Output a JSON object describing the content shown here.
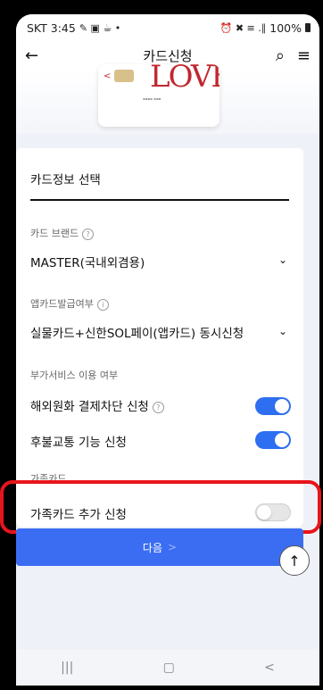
{
  "status": {
    "time": "SKT 3:45",
    "left_icons": "✎ ▣ ☕ •",
    "right_icons": "⏰ ✖ ≡ .∥",
    "battery": "100%"
  },
  "appbar": {
    "title": "카드신청"
  },
  "section": {
    "title": "카드정보 선택"
  },
  "brand": {
    "label": "카드 브랜드",
    "value": "MASTER(국내외겸용)"
  },
  "appcard": {
    "label": "앱카드발급여부",
    "value": "실물카드+신한SOL페이(앱카드) 동시신청"
  },
  "extra": {
    "label": "부가서비스 이용 여부",
    "items": [
      {
        "label": "해외원화 결제차단 신청",
        "on": true
      },
      {
        "label": "후불교통 기능 신청",
        "on": true
      }
    ]
  },
  "family": {
    "label": "가족카드",
    "item": "가족카드 추가 신청",
    "on": false
  },
  "next": {
    "label": "다음",
    "arrow": ">"
  },
  "colors": {
    "accent": "#3a6df2",
    "highlight": "#e8141b"
  },
  "icons": {
    "back": "←",
    "search": "⌕",
    "menu": "≡",
    "top": "↑",
    "nav_recent": "|||",
    "nav_home": "▢",
    "nav_back": "<"
  }
}
